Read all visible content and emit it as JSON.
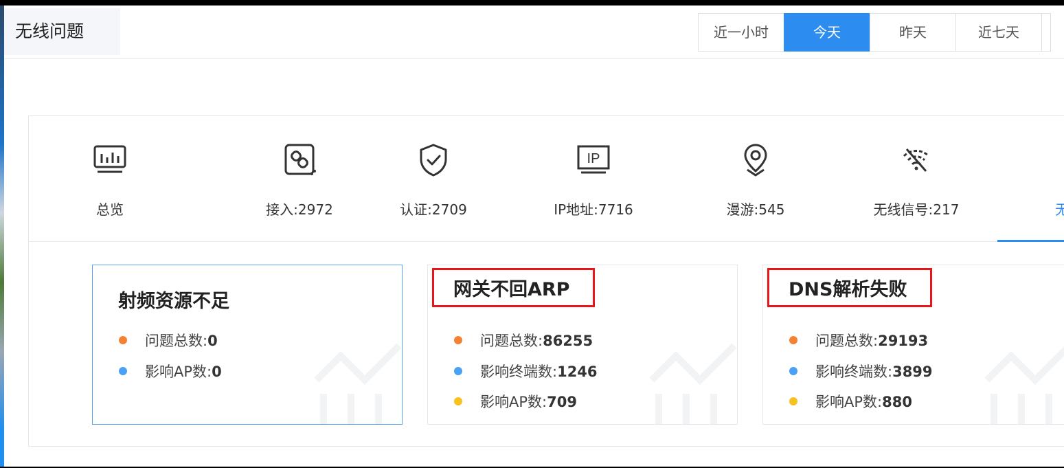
{
  "header": {
    "title": "无线问题",
    "time_ranges": [
      {
        "label": "近一小时",
        "active": false
      },
      {
        "label": "今天",
        "active": true
      },
      {
        "label": "昨天",
        "active": false
      },
      {
        "label": "近七天",
        "active": false
      }
    ]
  },
  "categories": [
    {
      "label": "总览",
      "icon": "monitor-chart-icon"
    },
    {
      "label": "接入:2972",
      "icon": "link-access-icon"
    },
    {
      "label": "认证:2709",
      "icon": "shield-check-icon"
    },
    {
      "label": "IP地址:7716",
      "icon": "ip-address-icon"
    },
    {
      "label": "漫游:545",
      "icon": "location-pin-icon"
    },
    {
      "label": "无线信号:217",
      "icon": "wifi-off-icon"
    },
    {
      "label": "无法上",
      "icon": "partial-icon",
      "active": true
    }
  ],
  "cards": [
    {
      "title": "射频资源不足",
      "metrics": [
        {
          "label": "问题总数:",
          "value": "0",
          "color": "#f58232"
        },
        {
          "label": "影响AP数:",
          "value": "0",
          "color": "#4aa0f5"
        }
      ]
    },
    {
      "title": "网关不回ARP",
      "metrics": [
        {
          "label": "问题总数:",
          "value": "86255",
          "color": "#f58232"
        },
        {
          "label": "影响终端数:",
          "value": "1246",
          "color": "#4aa0f5"
        },
        {
          "label": "影响AP数:",
          "value": "709",
          "color": "#f7c21e"
        }
      ]
    },
    {
      "title": "DNS解析失败",
      "metrics": [
        {
          "label": "问题总数:",
          "value": "29193",
          "color": "#f58232"
        },
        {
          "label": "影响终端数:",
          "value": "3899",
          "color": "#4aa0f5"
        },
        {
          "label": "影响AP数:",
          "value": "880",
          "color": "#f7c21e"
        }
      ]
    }
  ]
}
